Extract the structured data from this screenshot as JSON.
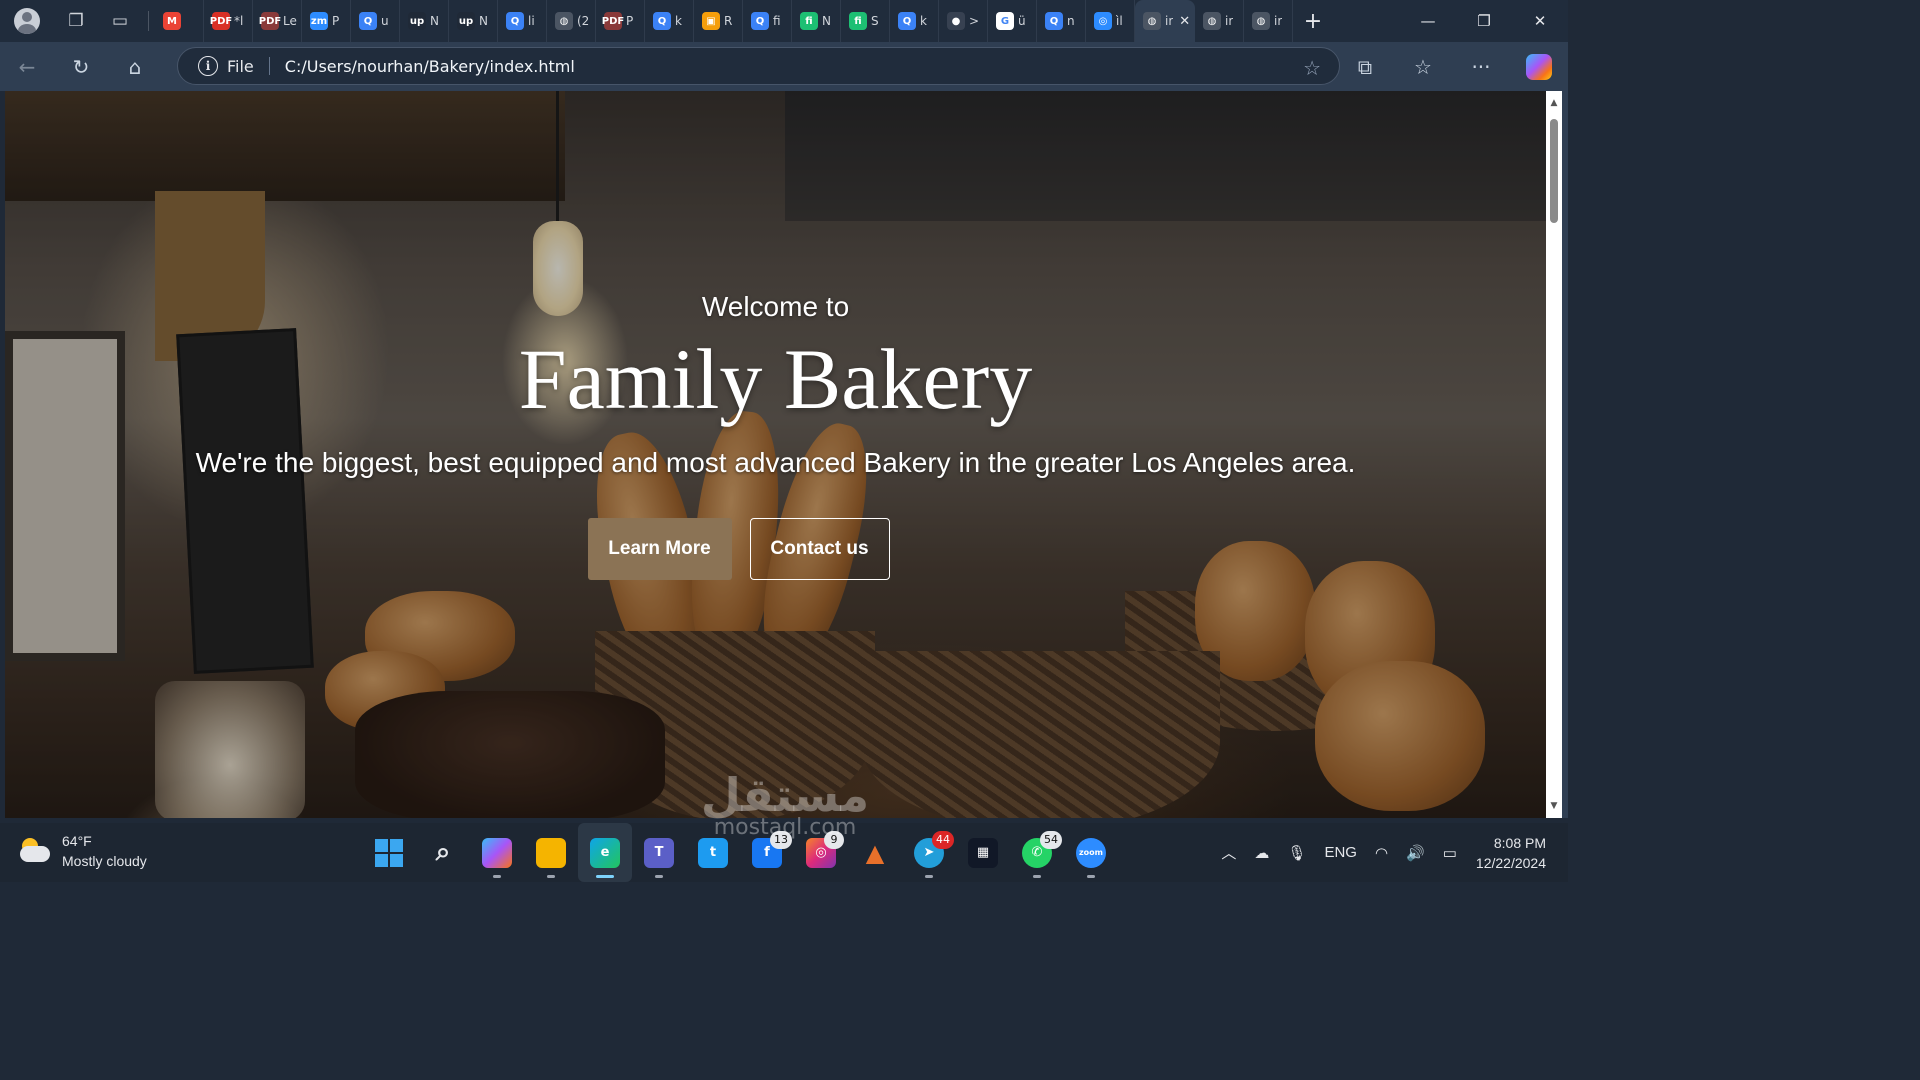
{
  "browser": {
    "profile_icon": "profile-avatar-icon",
    "tabs": [
      {
        "icon": "gmail-icon",
        "color": "#ea4335",
        "glyph": "M",
        "text": ""
      },
      {
        "icon": "pdf-icon",
        "color": "#d93025",
        "glyph": "PDF",
        "text": "*l"
      },
      {
        "icon": "pdf-icon",
        "color": "#8a3a3a",
        "glyph": "PDF",
        "text": "Le"
      },
      {
        "icon": "zoom-icon",
        "color": "#2d8cff",
        "glyph": "zm",
        "text": "P"
      },
      {
        "icon": "search-icon",
        "color": "#3b82f6",
        "glyph": "Q",
        "text": "u"
      },
      {
        "icon": "upwork-icon",
        "color": "#1f2937",
        "glyph": "up",
        "text": "N"
      },
      {
        "icon": "upwork-icon",
        "color": "#1f2937",
        "glyph": "up",
        "text": "N"
      },
      {
        "icon": "search-icon",
        "color": "#3b82f6",
        "glyph": "Q",
        "text": "li"
      },
      {
        "icon": "globe-icon",
        "color": "#4b5563",
        "glyph": "◍",
        "text": "(2"
      },
      {
        "icon": "pdf-icon",
        "color": "#8a3a3a",
        "glyph": "PDF",
        "text": "P"
      },
      {
        "icon": "search-icon",
        "color": "#3b82f6",
        "glyph": "Q",
        "text": "k"
      },
      {
        "icon": "box-icon",
        "color": "#f59e0b",
        "glyph": "▣",
        "text": "R"
      },
      {
        "icon": "search-icon",
        "color": "#3b82f6",
        "glyph": "Q",
        "text": "fi"
      },
      {
        "icon": "fiverr-icon",
        "color": "#1dbf73",
        "glyph": "fi",
        "text": "N"
      },
      {
        "icon": "fiverr-icon",
        "color": "#1dbf73",
        "glyph": "fi",
        "text": "S"
      },
      {
        "icon": "search-icon",
        "color": "#3b82f6",
        "glyph": "Q",
        "text": "k"
      },
      {
        "icon": "dark-circle-icon",
        "color": "#374151",
        "glyph": "●",
        "text": ">"
      },
      {
        "icon": "google-icon",
        "color": "#ffffff",
        "glyph": "G",
        "text": "ü"
      },
      {
        "icon": "search-icon",
        "color": "#3b82f6",
        "glyph": "Q",
        "text": "n"
      },
      {
        "icon": "ring-icon",
        "color": "#2d8cff",
        "glyph": "◎",
        "text": "ìl"
      },
      {
        "icon": "globe-icon",
        "color": "#4b5563",
        "glyph": "◍",
        "text": "ir",
        "active": true
      },
      {
        "icon": "globe-icon",
        "color": "#4b5563",
        "glyph": "◍",
        "text": "ir"
      },
      {
        "icon": "globe-icon",
        "color": "#4b5563",
        "glyph": "◍",
        "text": "ir"
      }
    ],
    "active_tab_close": "✕",
    "new_tab": "+",
    "window_controls": {
      "minimize": "—",
      "restore": "❐",
      "close": "✕"
    },
    "address_bar": {
      "scheme": "File",
      "url": "C:/Users/nourhan/Bakery/index.html",
      "info_glyph": "i",
      "star_icon": "favorite-star-icon"
    }
  },
  "page": {
    "hero": {
      "welcome": "Welcome to",
      "title": "Family Bakery",
      "subtitle": "We're the biggest, best equipped and most advanced Bakery in the greater Los Angeles area.",
      "primary_button": "Learn More",
      "secondary_button": "Contact us",
      "primary_button_color": "#8b7355"
    }
  },
  "watermark": {
    "arabic": "مستقل",
    "latin": "mostaql.com"
  },
  "taskbar": {
    "weather": {
      "temp": "64°F",
      "condition": "Mostly cloudy"
    },
    "apps": [
      {
        "name": "start",
        "glyph": ""
      },
      {
        "name": "search",
        "glyph": "⌕"
      },
      {
        "name": "copilot",
        "glyph": ""
      },
      {
        "name": "file-explorer",
        "glyph": ""
      },
      {
        "name": "edge",
        "glyph": "e",
        "active": true
      },
      {
        "name": "teams",
        "glyph": "T"
      },
      {
        "name": "twitter",
        "glyph": "t"
      },
      {
        "name": "facebook",
        "glyph": "f",
        "badge": "13"
      },
      {
        "name": "instagram",
        "glyph": "◎",
        "badge": "9"
      },
      {
        "name": "matlab",
        "glyph": "▲"
      },
      {
        "name": "telegram",
        "glyph": "➤",
        "badge": "44"
      },
      {
        "name": "screen-recorder",
        "glyph": "▦"
      },
      {
        "name": "whatsapp",
        "glyph": "✆",
        "badge": "54"
      },
      {
        "name": "zoom",
        "glyph": "zoom"
      }
    ],
    "tray": {
      "language": "ENG",
      "time": "8:08 PM",
      "date": "12/22/2024"
    }
  }
}
